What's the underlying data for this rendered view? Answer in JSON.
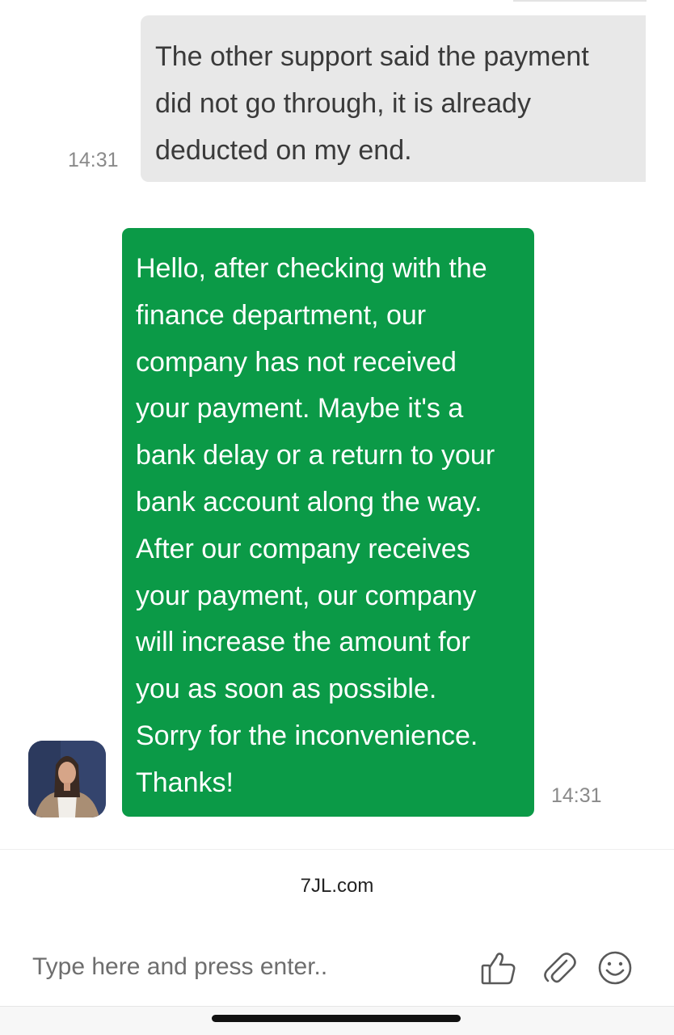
{
  "messages": [
    {
      "direction": "incoming",
      "lines": [
        "The other support said the payment",
        "did not go through, it is already",
        "deducted on my end."
      ],
      "time": "14:31"
    },
    {
      "direction": "outgoing",
      "lines": [
        "Hello, after checking with the",
        "finance department, our",
        "company has not received",
        "your payment. Maybe it's a",
        "bank delay or a return to your",
        "bank account along the way.",
        "After our company receives",
        "your payment, our company",
        "will increase the amount for",
        "you as soon as possible.",
        "Sorry for the inconvenience.",
        "Thanks!"
      ],
      "time": "14:31"
    }
  ],
  "footer": {
    "brand": "7JL.com"
  },
  "composer": {
    "placeholder": "Type here and press enter..",
    "icons": [
      "thumbs-up-icon",
      "paperclip-icon",
      "emoji-icon"
    ]
  },
  "colors": {
    "outgoing_bubble": "#0b9a47",
    "incoming_bubble": "#e8e8e8",
    "icon": "#5a5a5a"
  }
}
